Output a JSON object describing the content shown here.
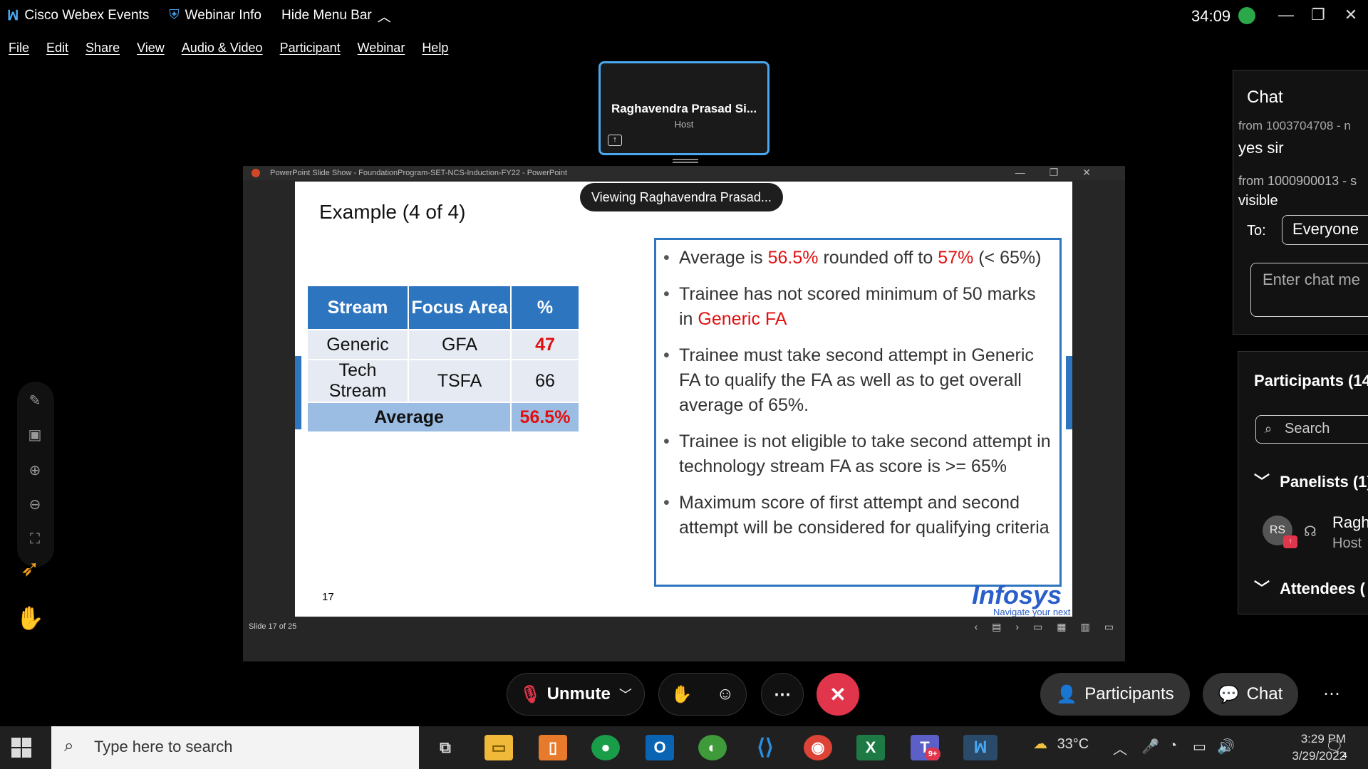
{
  "window": {
    "app_name": "Cisco Webex Events",
    "webinar_info": "Webinar Info",
    "hide_menu": "Hide Menu Bar",
    "timer": "34:09"
  },
  "menu": [
    "File",
    "Edit",
    "Share",
    "View",
    "Audio & Video",
    "Participant",
    "Webinar",
    "Help"
  ],
  "host_tile": {
    "name": "Raghavendra Prasad Si...",
    "role": "Host"
  },
  "ppt_window": {
    "title": "PowerPoint Slide Show  -  FoundationProgram-SET-NCS-Induction-FY22  -  PowerPoint",
    "status": "Slide 17 of 25"
  },
  "viewing_badge": "Viewing Raghavendra Prasad...",
  "slide": {
    "title": "Example (4 of 4)",
    "number": "17",
    "table": {
      "headers": [
        "Stream",
        "Focus Area",
        "%"
      ],
      "rows": [
        [
          "Generic",
          "GFA",
          "47"
        ],
        [
          "Tech Stream",
          "TSFA",
          "66"
        ]
      ],
      "avg_label": "Average",
      "avg_value": "56.5%"
    },
    "bullets": {
      "b1_a": "Average is ",
      "b1_b": "56.5%",
      "b1_c": " rounded off to ",
      "b1_d": "57%",
      "b1_e": " (< 65%)",
      "b2_a": "Trainee has not scored minimum of 50 marks in ",
      "b2_b": "Generic FA",
      "b3": "Trainee must take second attempt in Generic FA to qualify the FA as well as to get overall average of 65%.",
      "b4": "Trainee is not eligible to take second attempt in technology stream FA as score is >= 65%",
      "b5": "Maximum score of first attempt and second attempt will be considered for qualifying criteria"
    },
    "brand": "Infosys",
    "brand_tagline": "Navigate your next"
  },
  "chat": {
    "title": "Chat",
    "msg1_from": "from 1003704708 - n",
    "msg1": "yes sir",
    "msg2_from": "from 1000900013 - s",
    "msg2": "visible",
    "to_label": "To:",
    "to_value": "Everyone",
    "input_placeholder": "Enter chat me"
  },
  "participants": {
    "title": "Participants (14",
    "search_placeholder": "Search",
    "panelists": "Panelists (1)",
    "attendees": "Attendees (",
    "avatar_initials": "RS",
    "panelist_name": "Ragh",
    "panelist_role": "Host"
  },
  "controls": {
    "unmute": "Unmute",
    "participants": "Participants",
    "chat": "Chat"
  },
  "taskbar": {
    "search_placeholder": "Type here to search",
    "temperature": "33°C",
    "time": "3:29 PM",
    "date": "3/29/2022",
    "notif_count": "4",
    "teams_badge": "9+"
  },
  "colors": {
    "accent_blue": "#2e75c0",
    "red": "#e01010",
    "leave_red": "#e0354b"
  }
}
